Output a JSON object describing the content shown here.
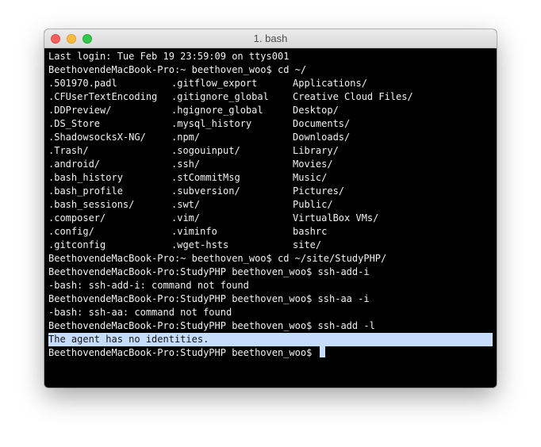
{
  "window": {
    "title": "1. bash"
  },
  "terminal": {
    "lines_before": [
      "Last login: Tue Feb 19 23:59:09 on ttys001",
      "BeethovendeMacBook-Pro:~ beethoven_woo$ cd ~/"
    ],
    "listing": [
      [
        ".501970.padl",
        ".gitflow_export",
        "Applications/"
      ],
      [
        ".CFUserTextEncoding",
        ".gitignore_global",
        "Creative Cloud Files/"
      ],
      [
        ".DDPreview/",
        ".hgignore_global",
        "Desktop/"
      ],
      [
        ".DS_Store",
        ".mysql_history",
        "Documents/"
      ],
      [
        ".ShadowsocksX-NG/",
        ".npm/",
        "Downloads/"
      ],
      [
        ".Trash/",
        ".sogouinput/",
        "Library/"
      ],
      [
        ".android/",
        ".ssh/",
        "Movies/"
      ],
      [
        ".bash_history",
        ".stCommitMsg",
        "Music/"
      ],
      [
        ".bash_profile",
        ".subversion/",
        "Pictures/"
      ],
      [
        ".bash_sessions/",
        ".swt/",
        "Public/"
      ],
      [
        ".composer/",
        ".vim/",
        "VirtualBox VMs/"
      ],
      [
        ".config/",
        ".viminfo",
        "bashrc"
      ],
      [
        ".gitconfig",
        ".wget-hsts",
        "site/"
      ]
    ],
    "lines_after": [
      "BeethovendeMacBook-Pro:~ beethoven_woo$ cd ~/site/StudyPHP/",
      "BeethovendeMacBook-Pro:StudyPHP beethoven_woo$ ssh-add-i",
      "-bash: ssh-add-i: command not found",
      "BeethovendeMacBook-Pro:StudyPHP beethoven_woo$ ssh-aa -i",
      "-bash: ssh-aa: command not found",
      "BeethovendeMacBook-Pro:StudyPHP beethoven_woo$ ssh-add -l"
    ],
    "highlighted_line": "The agent has no identities.",
    "prompt": "BeethovendeMacBook-Pro:StudyPHP beethoven_woo$ "
  }
}
